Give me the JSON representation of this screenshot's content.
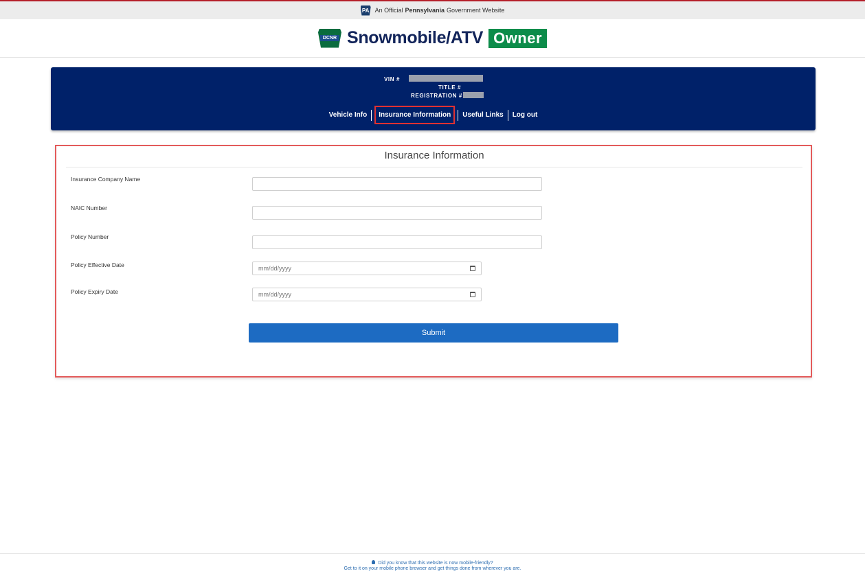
{
  "gov_banner": {
    "prefix": "An Official",
    "state": "Pennsylvania",
    "suffix": "Government Website",
    "badge": "PA"
  },
  "brand": {
    "logo_text": "DCNR",
    "title": "Snowmobile/ATV",
    "owner": "Owner"
  },
  "vehicle": {
    "vin_label": "VIN #",
    "title_label": "TITLE #",
    "registration_label": "REGISTRATION #"
  },
  "nav": {
    "items": [
      {
        "label": "Vehicle Info"
      },
      {
        "label": "Insurance Information"
      },
      {
        "label": "Useful Links"
      },
      {
        "label": "Log out"
      }
    ]
  },
  "form": {
    "title": "Insurance Information",
    "fields": [
      {
        "label": "Insurance Company Name",
        "value": ""
      },
      {
        "label": "NAIC Number",
        "value": ""
      },
      {
        "label": "Policy Number",
        "value": ""
      },
      {
        "label": "Policy Effective Date",
        "placeholder": "mm/dd/yyyy"
      },
      {
        "label": "Policy Expiry Date",
        "placeholder": "mm/dd/yyyy"
      }
    ],
    "submit_label": "Submit"
  },
  "footer": {
    "line1": "Did you know that this website is now mobile-friendly?",
    "line2": "Get to it on your mobile phone browser and get things done from wherever you are."
  },
  "colors": {
    "navy": "#002169",
    "owner_green": "#0c8c4a",
    "submit_blue": "#1d6bc2",
    "highlight_red": "#e35a5a"
  }
}
